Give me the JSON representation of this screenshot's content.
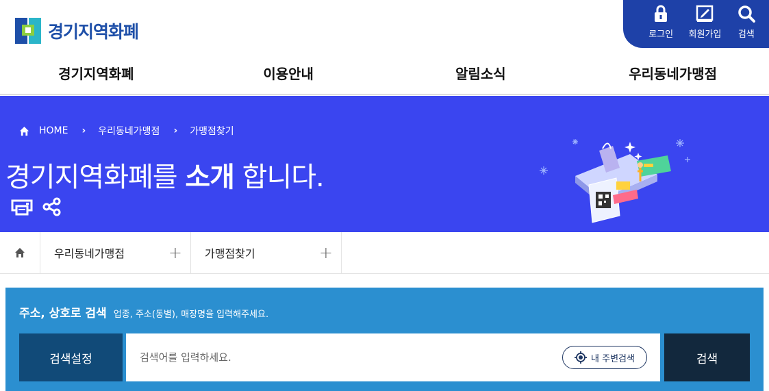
{
  "header": {
    "logo_text": "경기지역화폐",
    "util": [
      {
        "label": "로그인",
        "icon": "lock-icon"
      },
      {
        "label": "회원가입",
        "icon": "signup-pen-icon"
      },
      {
        "label": "검색",
        "icon": "search-icon"
      }
    ]
  },
  "gnb": {
    "items": [
      "경기지역화폐",
      "이용안내",
      "알림소식",
      "우리동네가맹점"
    ]
  },
  "visual": {
    "breadcrumb": {
      "home": "HOME",
      "level1": "우리동네가맹점",
      "level2": "가맹점찾기"
    },
    "title_pre": "경기지역화폐를 ",
    "title_bold": "소개",
    "title_post": " 합니다."
  },
  "subnav": {
    "items": [
      "우리동네가맹점",
      "가맹점찾기"
    ]
  },
  "search": {
    "guide_title": "주소, 상호로 검색",
    "guide_desc": "업종, 주소(동별), 매장명을 입력해주세요.",
    "setting_label": "검색설정",
    "placeholder": "검색어를 입력하세요.",
    "nearby_label": "내 주변검색",
    "submit_label": "검색"
  },
  "colors": {
    "primary_blue": "#1e41a8",
    "banner_blue": "#3a45f0",
    "search_bg": "#2b8fd0",
    "setting_bg": "#114a78",
    "submit_bg": "#12283d"
  }
}
